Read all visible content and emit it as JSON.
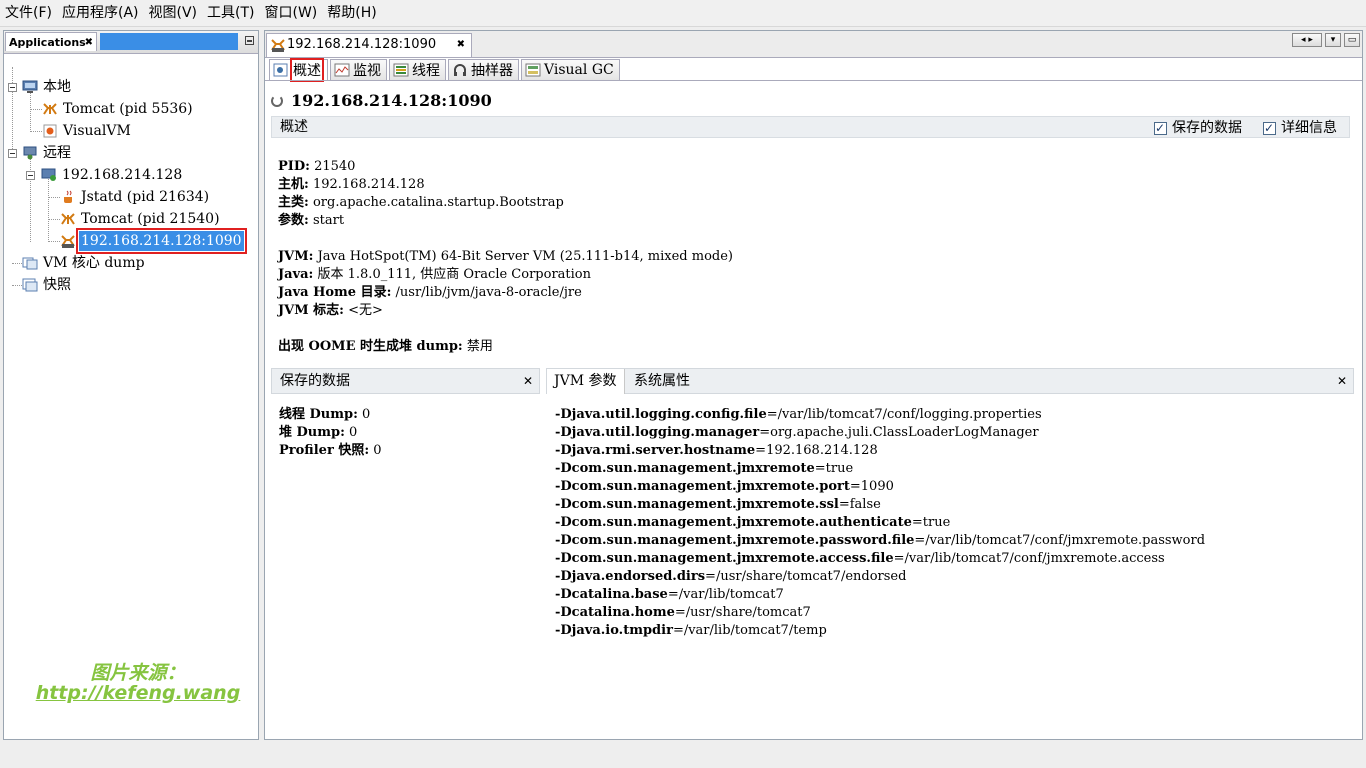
{
  "menubar": {
    "items": [
      "文件(F)",
      "应用程序(A)",
      "视图(V)",
      "工具(T)",
      "窗口(W)",
      "帮助(H)"
    ]
  },
  "left_panel": {
    "tab_title": "Applications",
    "tree": {
      "local": {
        "label": "本地",
        "children": [
          "Tomcat (pid 5536)",
          "VisualVM"
        ]
      },
      "remote": {
        "label": "远程",
        "host": "192.168.214.128",
        "children": [
          "Jstatd (pid 21634)",
          "Tomcat (pid 21540)",
          "192.168.214.128:1090"
        ],
        "selected": "192.168.214.128:1090"
      },
      "vm_core_dump": "VM 核心 dump",
      "snapshots": "快照"
    },
    "watermark": {
      "line1": "图片来源：",
      "line2": "http://kefeng.wang"
    }
  },
  "right_panel": {
    "document_tab": "192.168.214.128:1090",
    "sub_tabs": [
      "概述",
      "监视",
      "线程",
      "抽样器",
      "Visual GC"
    ],
    "active_sub_tab": "概述",
    "host_title": "192.168.214.128:1090",
    "overview_section": {
      "title": "概述",
      "saved_data_checkbox": "保存的数据",
      "details_checkbox": "详细信息"
    },
    "info": {
      "pid_label": "PID:",
      "pid": "21540",
      "host_label": "主机:",
      "host": "192.168.214.128",
      "mainclass_label": "主类:",
      "mainclass": "org.apache.catalina.startup.Bootstrap",
      "args_label": "参数:",
      "args": "start",
      "jvm_label": "JVM:",
      "jvm": "Java HotSpot(TM) 64-Bit Server VM (25.111-b14, mixed mode)",
      "java_label": "Java:",
      "java": "版本 1.8.0_111, 供应商 Oracle Corporation",
      "javahome_label": "Java Home 目录:",
      "javahome": "/usr/lib/jvm/java-8-oracle/jre",
      "jvmflags_label": "JVM 标志:",
      "jvmflags": "<无>",
      "oome_label": "出现 OOME 时生成堆 dump:",
      "oome": "禁用"
    },
    "saved_data_panel": {
      "title": "保存的数据",
      "thread_dump_label": "线程 Dump:",
      "thread_dump": "0",
      "heap_dump_label": "堆 Dump:",
      "heap_dump": "0",
      "profiler_label": "Profiler 快照:",
      "profiler": "0"
    },
    "jvm_panel": {
      "tabs": [
        "JVM 参数",
        "系统属性"
      ],
      "args": [
        {
          "key": "-Djava.util.logging.config.file",
          "value": "=/var/lib/tomcat7/conf/logging.properties"
        },
        {
          "key": "-Djava.util.logging.manager",
          "value": "=org.apache.juli.ClassLoaderLogManager"
        },
        {
          "key": "-Djava.rmi.server.hostname",
          "value": "=192.168.214.128"
        },
        {
          "key": "-Dcom.sun.management.jmxremote",
          "value": "=true"
        },
        {
          "key": "-Dcom.sun.management.jmxremote.port",
          "value": "=1090"
        },
        {
          "key": "-Dcom.sun.management.jmxremote.ssl",
          "value": "=false"
        },
        {
          "key": "-Dcom.sun.management.jmxremote.authenticate",
          "value": "=true"
        },
        {
          "key": "-Dcom.sun.management.jmxremote.password.file",
          "value": "=/var/lib/tomcat7/conf/jmxremote.password"
        },
        {
          "key": "-Dcom.sun.management.jmxremote.access.file",
          "value": "=/var/lib/tomcat7/conf/jmxremote.access"
        },
        {
          "key": "-Djava.endorsed.dirs",
          "value": "=/usr/share/tomcat7/endorsed"
        },
        {
          "key": "-Dcatalina.base",
          "value": "=/var/lib/tomcat7"
        },
        {
          "key": "-Dcatalina.home",
          "value": "=/usr/share/tomcat7"
        },
        {
          "key": "-Djava.io.tmpdir",
          "value": "=/var/lib/tomcat7/temp"
        }
      ]
    }
  }
}
